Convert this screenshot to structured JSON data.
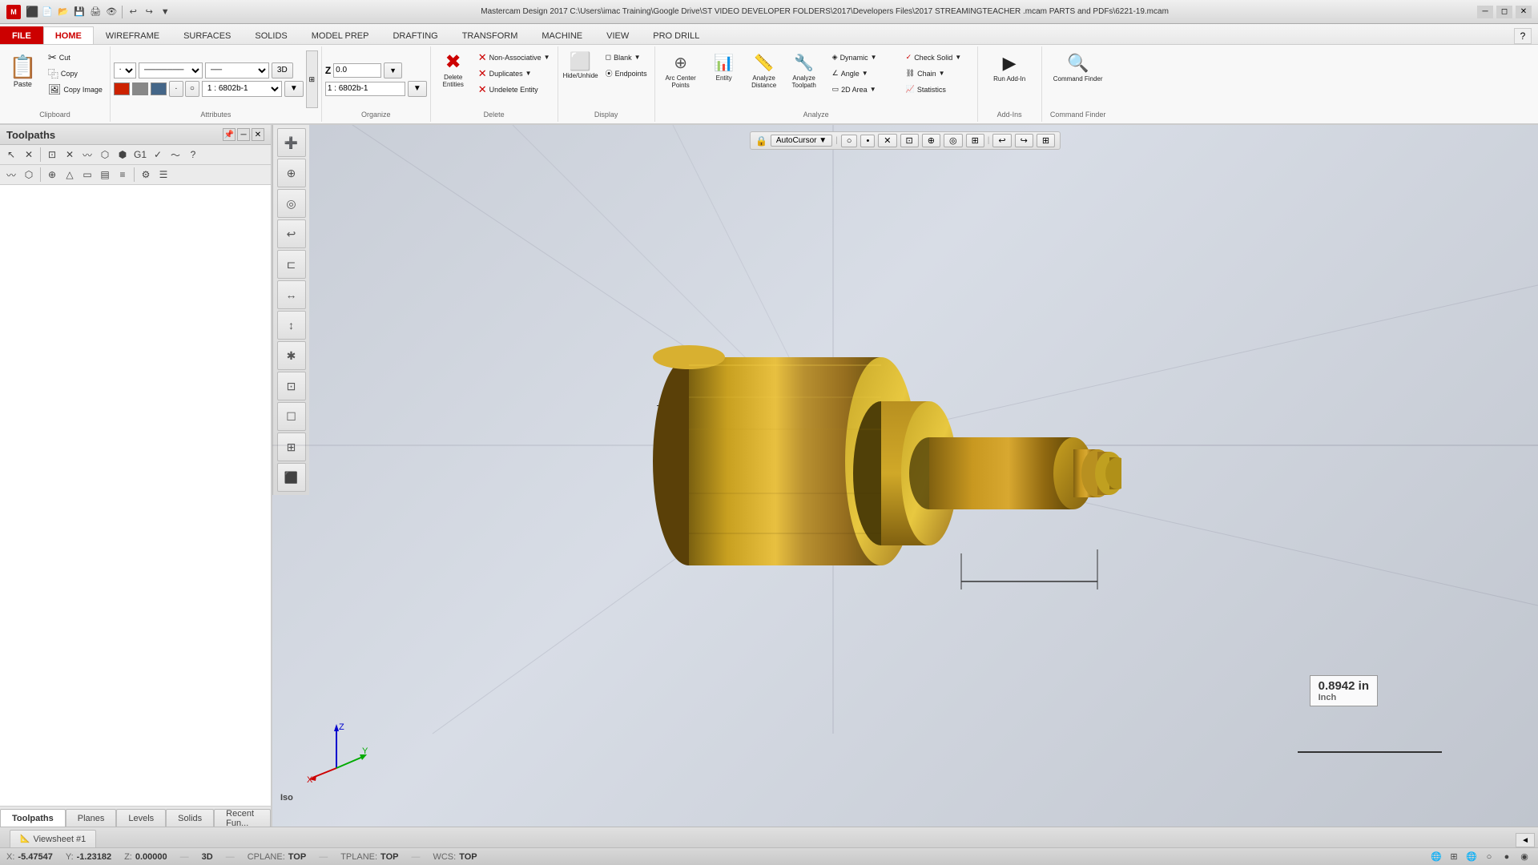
{
  "titlebar": {
    "title": "Mastercam Design 2017  C:\\Users\\imac Training\\Google Drive\\ST VIDEO DEVELOPER FOLDERS\\2017\\Developers Files\\2017 STREAMINGTEACHER .mcam PARTS and PDFs\\6221-19.mcam",
    "app_icon": "M"
  },
  "quickaccess": {
    "buttons": [
      "💾",
      "📂",
      "💾",
      "🖨",
      "👁",
      "↩",
      "↪",
      "▼"
    ]
  },
  "ribbon": {
    "tabs": [
      "FILE",
      "HOME",
      "WIREFRAME",
      "SURFACES",
      "SOLIDS",
      "MODEL PREP",
      "DRAFTING",
      "TRANSFORM",
      "MACHINE",
      "VIEW",
      "PRO DRILL"
    ],
    "active_tab": "HOME",
    "groups": {
      "clipboard": {
        "label": "Clipboard",
        "paste_label": "Paste",
        "cut_label": "Cut",
        "copy_label": "Copy",
        "copy_image_label": "Copy Image"
      },
      "attributes": {
        "label": "Attributes",
        "expand_icon": "⊞"
      },
      "organize": {
        "label": "Organize",
        "z_label": "Z",
        "z_value": "0.0",
        "level_label": "1 : 6802b-1",
        "view_3d": "3D"
      },
      "delete": {
        "label": "Delete",
        "delete_entities": "Delete Entities",
        "non_associative": "Non-Associative",
        "duplicates": "Duplicates",
        "undelete": "Undelete Entity"
      },
      "display": {
        "label": "Display",
        "hide_unhide": "Hide/Unhide",
        "blank": "Blank",
        "endpoints": "Endpoints"
      },
      "analyze": {
        "label": "Analyze",
        "arc_center_points": "Arc Center Points",
        "analyze_entity": "Analyze Entity",
        "analyze_distance": "Analyze Distance",
        "analyze_toolpath": "Analyze Toolpath",
        "dynamic": "Dynamic",
        "check_solid": "Check Solid",
        "angle": "Angle",
        "chain": "Chain",
        "two_d_area": "2D Area",
        "statistics": "Statistics",
        "entity_label": "Entity"
      },
      "add_ins": {
        "label": "Add-Ins",
        "run_add_in": "Run Add-In"
      },
      "command_finder": {
        "label": "Command Finder",
        "button_label": "Command Finder"
      }
    }
  },
  "left_panel": {
    "title": "Toolpaths",
    "bottom_tabs": [
      "Toolpaths",
      "Planes",
      "Levels",
      "Solids",
      "Recent Fun..."
    ]
  },
  "viewport": {
    "autocursor_label": "AutoCursor",
    "iso_label": "Iso",
    "viewsheet": "Viewsheet #1",
    "scroll_indicator": "◄"
  },
  "dimension": {
    "value": "0.8942 in",
    "unit": "Inch"
  },
  "statusbar": {
    "x_label": "X:",
    "x_val": "-5.47547",
    "y_label": "Y:",
    "y_val": "-1.23182",
    "z_label": "Z:",
    "z_val": "0.00000",
    "mode": "3D",
    "cplane_label": "CPLANE:",
    "cplane_val": "TOP",
    "tplane_label": "TPLANE:",
    "tplane_val": "TOP",
    "wcs_label": "WCS:",
    "wcs_val": "TOP"
  },
  "right_panel_buttons": [
    "➕",
    "✚",
    "◎",
    "↩",
    "⊏",
    "↔",
    "↕",
    "🖱",
    "⊡",
    "☐",
    "🔲",
    "⬛"
  ]
}
